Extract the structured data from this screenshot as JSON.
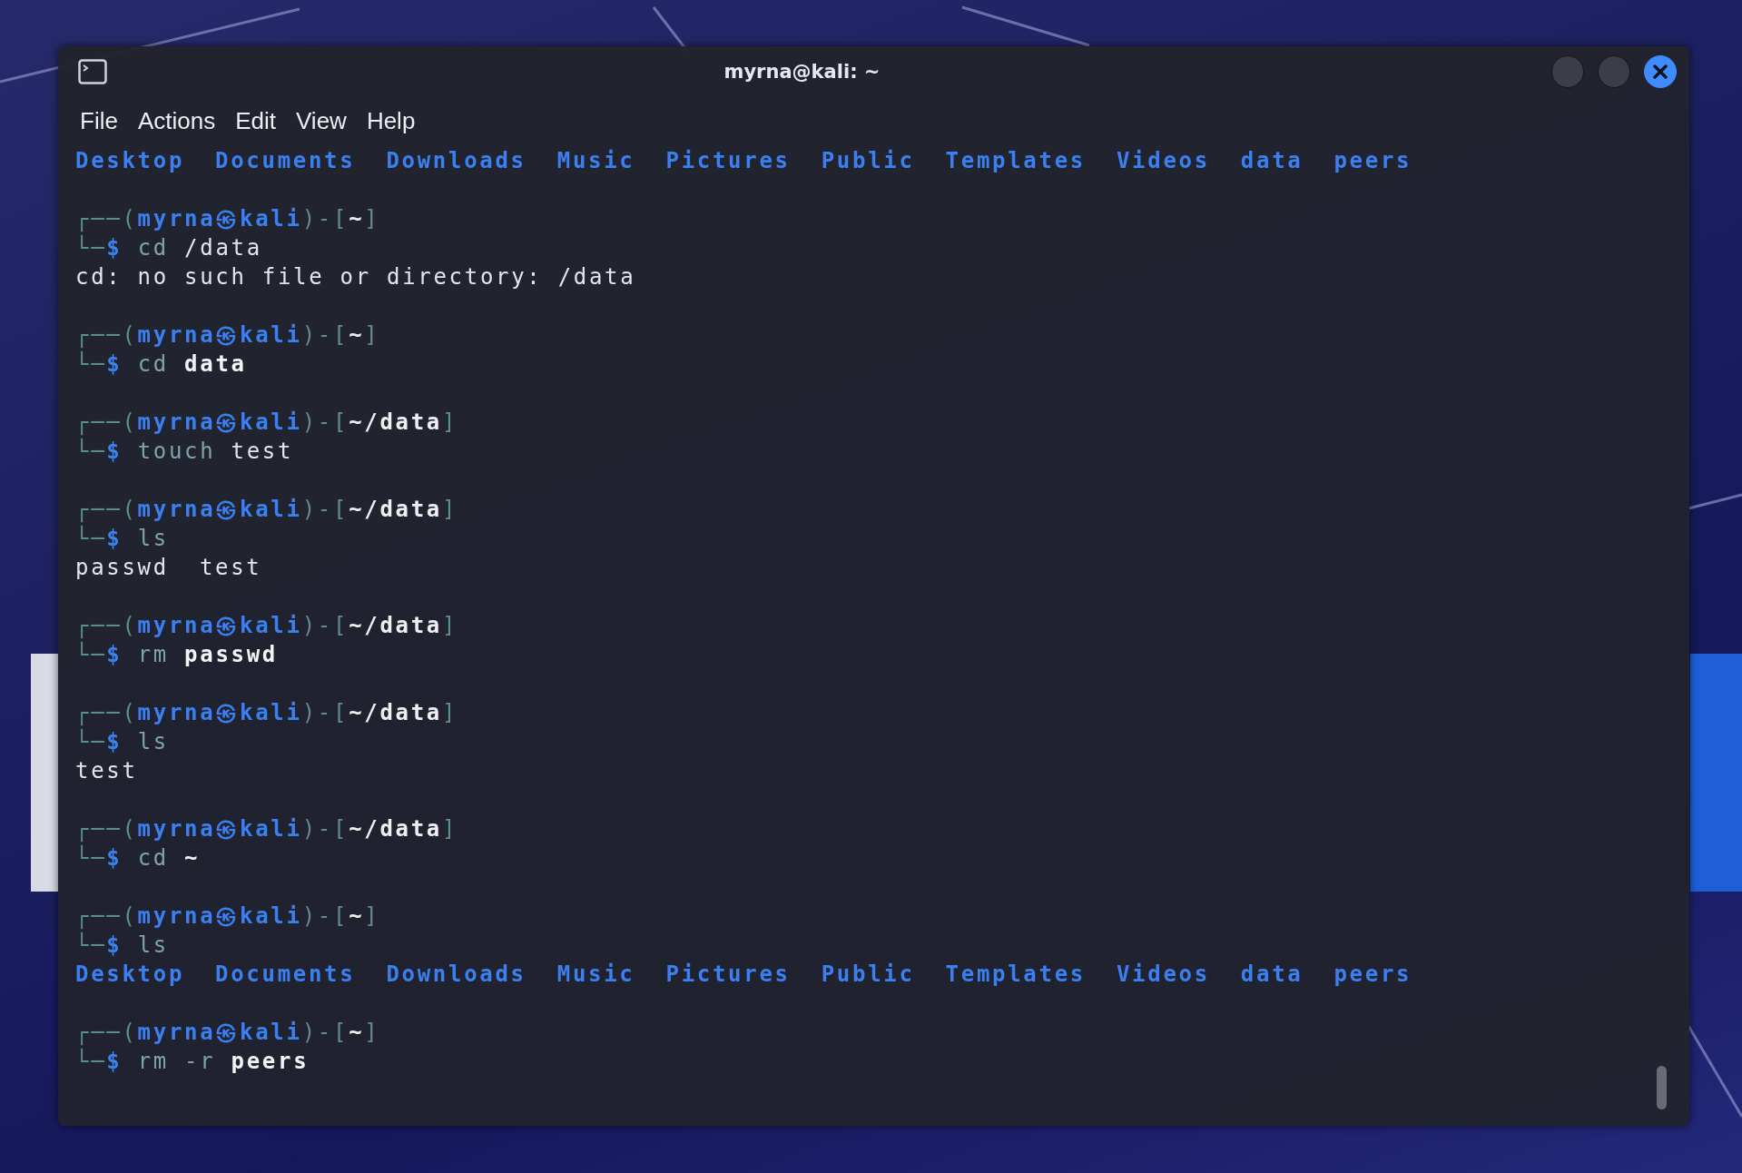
{
  "window": {
    "title": "myrna@kali: ~"
  },
  "menu": [
    "File",
    "Actions",
    "Edit",
    "View",
    "Help"
  ],
  "terminal": {
    "entries": [
      {
        "kind": "output",
        "items": [
          {
            "text": "Desktop",
            "kind": "dir"
          },
          {
            "text": "Documents",
            "kind": "dir"
          },
          {
            "text": "Downloads",
            "kind": "dir"
          },
          {
            "text": "Music",
            "kind": "dir"
          },
          {
            "text": "Pictures",
            "kind": "dir"
          },
          {
            "text": "Public",
            "kind": "dir"
          },
          {
            "text": "Templates",
            "kind": "dir"
          },
          {
            "text": "Videos",
            "kind": "dir"
          },
          {
            "text": "data",
            "kind": "dir"
          },
          {
            "text": "peers",
            "kind": "dir"
          }
        ]
      },
      {
        "kind": "prompt",
        "open": "┌──(",
        "user": "myrna",
        "at": "㉿",
        "host": "kali",
        "sep": ")-[",
        "path": "~",
        "close": "]",
        "corner": "└─",
        "sigil": "$",
        "command": [
          {
            "text": "cd",
            "kind": "command"
          },
          {
            "text": "/data",
            "kind": "text"
          }
        ]
      },
      {
        "kind": "output",
        "items": [
          {
            "text": "cd: no such file or directory: /data",
            "kind": "message"
          }
        ]
      },
      {
        "kind": "prompt",
        "open": "┌──(",
        "user": "myrna",
        "at": "㉿",
        "host": "kali",
        "sep": ")-[",
        "path": "~",
        "close": "]",
        "corner": "└─",
        "sigil": "$",
        "command": [
          {
            "text": "cd",
            "kind": "command"
          },
          {
            "text": "data",
            "kind": "path"
          }
        ]
      },
      {
        "kind": "prompt",
        "open": "┌──(",
        "user": "myrna",
        "at": "㉿",
        "host": "kali",
        "sep": ")-[",
        "path": "~/data",
        "close": "]",
        "corner": "└─",
        "sigil": "$",
        "command": [
          {
            "text": "touch",
            "kind": "command"
          },
          {
            "text": "test",
            "kind": "text"
          }
        ]
      },
      {
        "kind": "prompt",
        "open": "┌──(",
        "user": "myrna",
        "at": "㉿",
        "host": "kali",
        "sep": ")-[",
        "path": "~/data",
        "close": "]",
        "corner": "└─",
        "sigil": "$",
        "command": [
          {
            "text": "ls",
            "kind": "command"
          }
        ]
      },
      {
        "kind": "output",
        "items": [
          {
            "text": "passwd",
            "kind": "file"
          },
          {
            "text": "test",
            "kind": "file"
          }
        ]
      },
      {
        "kind": "prompt",
        "open": "┌──(",
        "user": "myrna",
        "at": "㉿",
        "host": "kali",
        "sep": ")-[",
        "path": "~/data",
        "close": "]",
        "corner": "└─",
        "sigil": "$",
        "command": [
          {
            "text": "rm",
            "kind": "command"
          },
          {
            "text": "passwd",
            "kind": "path"
          }
        ]
      },
      {
        "kind": "prompt",
        "open": "┌──(",
        "user": "myrna",
        "at": "㉿",
        "host": "kali",
        "sep": ")-[",
        "path": "~/data",
        "close": "]",
        "corner": "└─",
        "sigil": "$",
        "command": [
          {
            "text": "ls",
            "kind": "command"
          }
        ]
      },
      {
        "kind": "output",
        "items": [
          {
            "text": "test",
            "kind": "file"
          }
        ]
      },
      {
        "kind": "prompt",
        "open": "┌──(",
        "user": "myrna",
        "at": "㉿",
        "host": "kali",
        "sep": ")-[",
        "path": "~/data",
        "close": "]",
        "corner": "└─",
        "sigil": "$",
        "command": [
          {
            "text": "cd",
            "kind": "command"
          },
          {
            "text": "~",
            "kind": "path"
          }
        ]
      },
      {
        "kind": "prompt",
        "open": "┌──(",
        "user": "myrna",
        "at": "㉿",
        "host": "kali",
        "sep": ")-[",
        "path": "~",
        "close": "]",
        "corner": "└─",
        "sigil": "$",
        "command": [
          {
            "text": "ls",
            "kind": "command"
          }
        ]
      },
      {
        "kind": "output",
        "items": [
          {
            "text": "Desktop",
            "kind": "dir"
          },
          {
            "text": "Documents",
            "kind": "dir"
          },
          {
            "text": "Downloads",
            "kind": "dir"
          },
          {
            "text": "Music",
            "kind": "dir"
          },
          {
            "text": "Pictures",
            "kind": "dir"
          },
          {
            "text": "Public",
            "kind": "dir"
          },
          {
            "text": "Templates",
            "kind": "dir"
          },
          {
            "text": "Videos",
            "kind": "dir"
          },
          {
            "text": "data",
            "kind": "dir"
          },
          {
            "text": "peers",
            "kind": "dir"
          }
        ]
      },
      {
        "kind": "prompt",
        "open": "┌──(",
        "user": "myrna",
        "at": "㉿",
        "host": "kali",
        "sep": ")-[",
        "path": "~",
        "close": "]",
        "corner": "└─",
        "sigil": "$",
        "command": [
          {
            "text": "rm",
            "kind": "command"
          },
          {
            "text": "-r",
            "kind": "option"
          },
          {
            "text": "peers",
            "kind": "path"
          }
        ]
      }
    ]
  }
}
